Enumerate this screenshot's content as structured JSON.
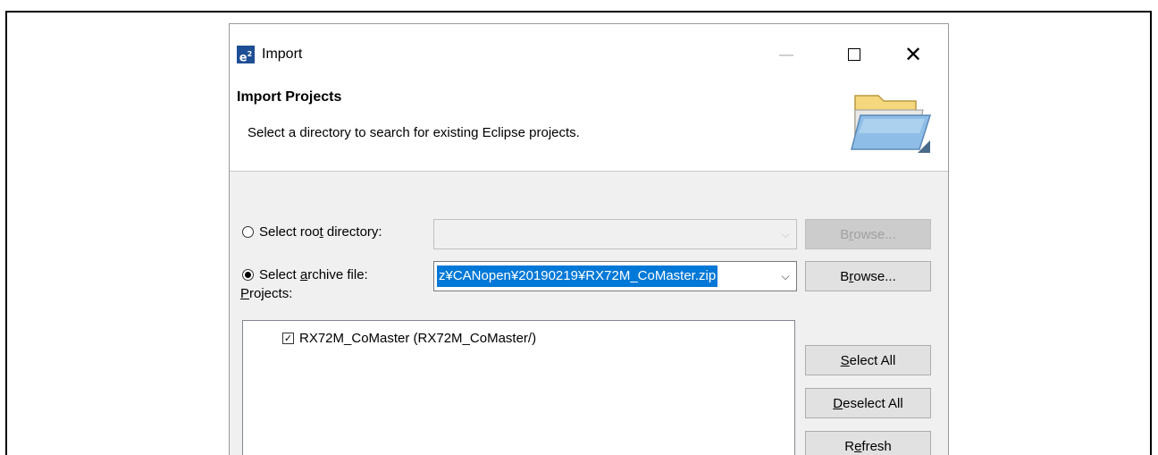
{
  "dialog": {
    "app_icon_text": "e",
    "app_icon_sup": "2",
    "title": "Import",
    "header": {
      "title": "Import Projects",
      "description": "Select a directory to search for existing Eclipse projects."
    },
    "root_directory": {
      "label_pre": "Select roo",
      "label_key": "t",
      "label_post": " directory:",
      "value": "",
      "selected": false,
      "browse_pre": "B",
      "browse_key": "r",
      "browse_post": "owse..."
    },
    "archive_file": {
      "label_pre": "Select ",
      "label_key": "a",
      "label_post": "rchive file:",
      "value": "z¥CANopen¥20190219¥RX72M_CoMaster.zip",
      "selected": true,
      "browse_pre": "B",
      "browse_key": "r",
      "browse_post": "owse..."
    },
    "projects_label_key": "P",
    "projects_label_post": "rojects:",
    "projects": [
      {
        "label": "RX72M_CoMaster (RX72M_CoMaster/)",
        "checked": true
      }
    ],
    "buttons": {
      "select_all_key": "S",
      "select_all_post": "elect All",
      "deselect_all_key": "D",
      "deselect_all_post": "eselect All",
      "refresh_pre": "R",
      "refresh_key": "e",
      "refresh_post": "fresh"
    }
  }
}
